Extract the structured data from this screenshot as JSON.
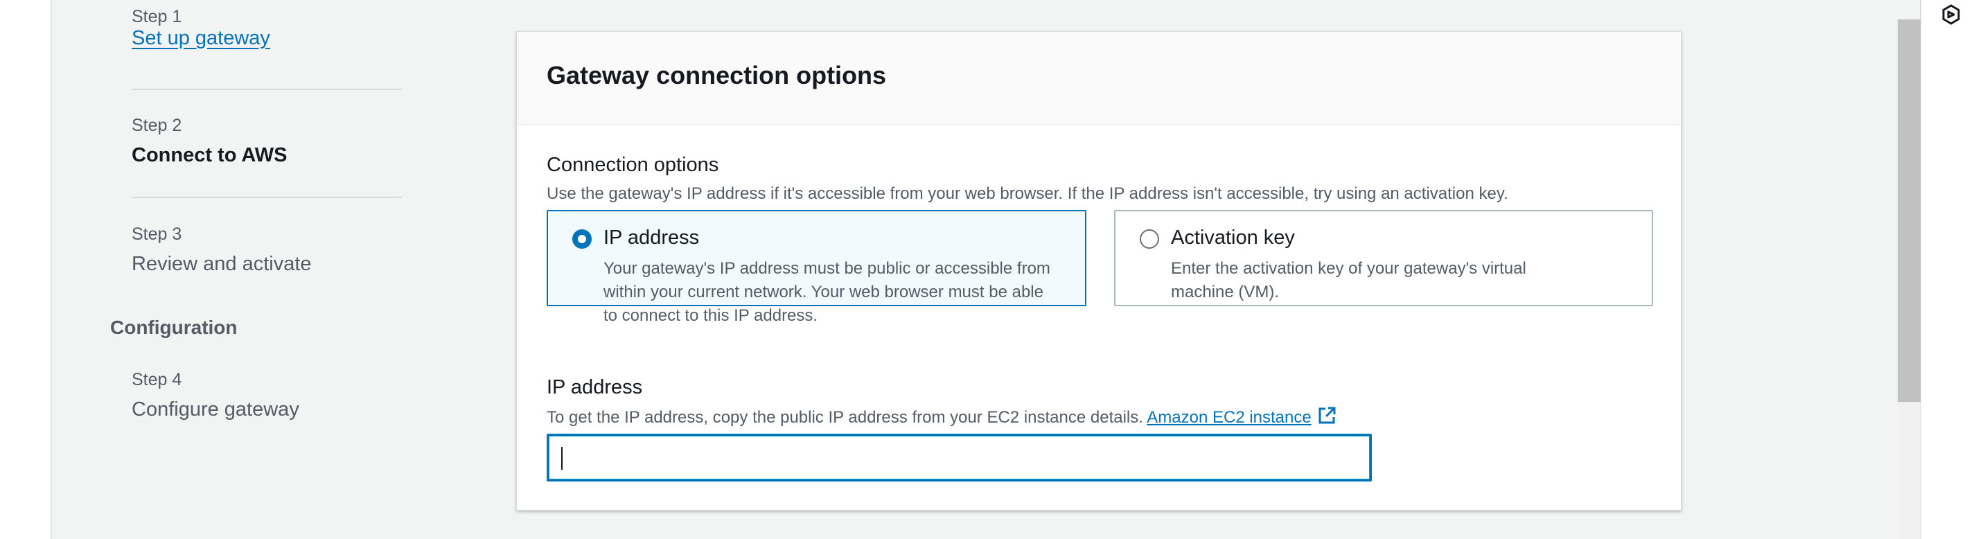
{
  "steps": [
    {
      "number": "Step 1",
      "title": "Set up gateway",
      "state": "link"
    },
    {
      "number": "Step 2",
      "title": "Connect to AWS",
      "state": "current"
    },
    {
      "number": "Step 3",
      "title": "Review and activate",
      "state": "upcoming"
    },
    {
      "number": "Step 4",
      "title": "Configure gateway",
      "state": "upcoming"
    }
  ],
  "sections": {
    "configuration": "Configuration"
  },
  "panel": {
    "title": "Gateway connection options",
    "connection_options": {
      "label": "Connection options",
      "description": "Use the gateway's IP address if it's accessible from your web browser. If the IP address isn't accessible, try using an activation key.",
      "options": [
        {
          "label": "IP address",
          "description": "Your gateway's IP address must be public or accessible from within your current network. Your web browser must be able to connect to this IP address.",
          "selected": true
        },
        {
          "label": "Activation key",
          "description": "Enter the activation key of your gateway's virtual machine (VM).",
          "selected": false
        }
      ]
    },
    "ip_address": {
      "label": "IP address",
      "description": "To get the IP address, copy the public IP address from your EC2 instance details.",
      "link_text": "Amazon EC2 instance",
      "value": ""
    }
  },
  "icons": {
    "external_link": "external-link-icon",
    "corner": "hexagon-logo-icon"
  },
  "colors": {
    "accent": "#0073bb",
    "selected_bg": "#f1faff",
    "page_bg": "#f2f3f3"
  }
}
